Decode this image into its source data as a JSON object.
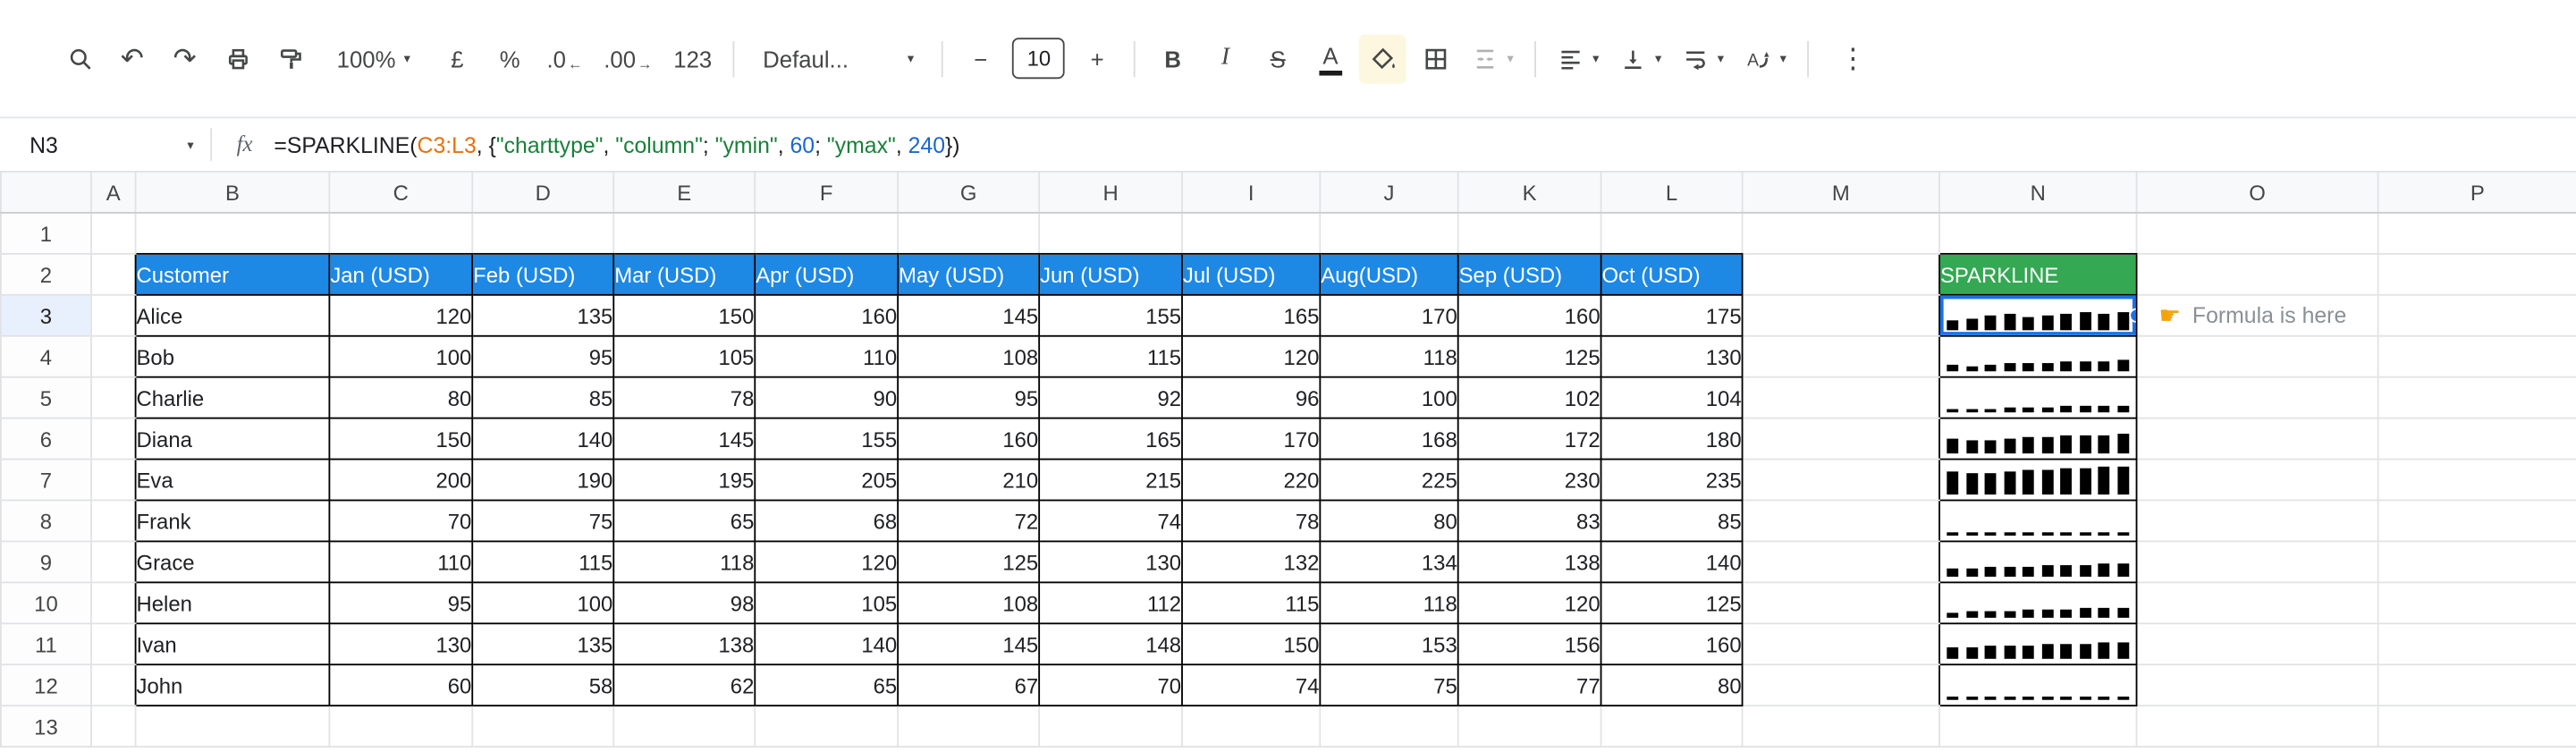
{
  "toolbar": {
    "zoom_value": "100%",
    "currency_label": "£",
    "percent_label": "%",
    "decrease_decimal_label": ".0",
    "increase_decimal_label": ".00",
    "number_format_label": "123",
    "font_value": "Defaul...",
    "minus_label": "−",
    "font_size_value": "10",
    "plus_label": "+",
    "bold_label": "B",
    "italic_label": "I",
    "strikethrough_label": "S",
    "text_color_label": "A",
    "more_label": "⋮",
    "icons": {
      "undo": "↶",
      "redo": "↷",
      "caret": "▾",
      "arrow_left": "←",
      "arrow_right": "→"
    }
  },
  "formula_bar": {
    "cell_ref": "N3",
    "fx_label": "fx",
    "colors": {
      "plain": "#202124",
      "range": "#e8710a",
      "string": "#188038",
      "number": "#1967d2"
    },
    "parts": [
      {
        "t": "=SPARKLINE(",
        "c": "plain"
      },
      {
        "t": "C3:L3",
        "c": "range"
      },
      {
        "t": ", {",
        "c": "plain"
      },
      {
        "t": "\"charttype\"",
        "c": "string"
      },
      {
        "t": ", ",
        "c": "plain"
      },
      {
        "t": "\"column\"",
        "c": "string"
      },
      {
        "t": "; ",
        "c": "plain"
      },
      {
        "t": "\"ymin\"",
        "c": "string"
      },
      {
        "t": ", ",
        "c": "plain"
      },
      {
        "t": "60",
        "c": "number"
      },
      {
        "t": "; ",
        "c": "plain"
      },
      {
        "t": "\"ymax\"",
        "c": "string"
      },
      {
        "t": ", ",
        "c": "plain"
      },
      {
        "t": "240",
        "c": "number"
      },
      {
        "t": "})",
        "c": "plain"
      }
    ]
  },
  "grid": {
    "column_letters": [
      "A",
      "B",
      "C",
      "D",
      "E",
      "F",
      "G",
      "H",
      "I",
      "J",
      "K",
      "L",
      "M",
      "N",
      "O",
      "P"
    ],
    "row_numbers": [
      1,
      2,
      3,
      4,
      5,
      6,
      7,
      8,
      9,
      10,
      11,
      12,
      13
    ],
    "selected_column": "N",
    "selected_row": 3,
    "selected_cell": "N3",
    "selection_color": "#1a73e8"
  },
  "table": {
    "header_bg": "#1e88e5",
    "headers": [
      "Customer",
      "Jan (USD)",
      "Feb (USD)",
      "Mar (USD)",
      "Apr (USD)",
      "May (USD)",
      "Jun (USD)",
      "Jul (USD)",
      "Aug(USD)",
      "Sep (USD)",
      "Oct (USD)"
    ],
    "rows": [
      {
        "customer": "Alice",
        "values": [
          120,
          135,
          150,
          160,
          145,
          155,
          165,
          170,
          160,
          175
        ]
      },
      {
        "customer": "Bob",
        "values": [
          100,
          95,
          105,
          110,
          108,
          115,
          120,
          118,
          125,
          130
        ]
      },
      {
        "customer": "Charlie",
        "values": [
          80,
          85,
          78,
          90,
          95,
          92,
          96,
          100,
          102,
          104
        ]
      },
      {
        "customer": "Diana",
        "values": [
          150,
          140,
          145,
          155,
          160,
          165,
          170,
          168,
          172,
          180
        ]
      },
      {
        "customer": "Eva",
        "values": [
          200,
          190,
          195,
          205,
          210,
          215,
          220,
          225,
          230,
          235
        ]
      },
      {
        "customer": "Frank",
        "values": [
          70,
          75,
          65,
          68,
          72,
          74,
          78,
          80,
          83,
          85
        ]
      },
      {
        "customer": "Grace",
        "values": [
          110,
          115,
          118,
          120,
          125,
          130,
          132,
          134,
          138,
          140
        ]
      },
      {
        "customer": "Helen",
        "values": [
          95,
          100,
          98,
          105,
          108,
          112,
          115,
          118,
          120,
          125
        ]
      },
      {
        "customer": "Ivan",
        "values": [
          130,
          135,
          138,
          140,
          145,
          148,
          150,
          153,
          156,
          160
        ]
      },
      {
        "customer": "John",
        "values": [
          60,
          58,
          62,
          65,
          67,
          70,
          74,
          75,
          77,
          80
        ]
      }
    ]
  },
  "sparkline": {
    "header": "SPARKLINE",
    "header_bg": "#34a853",
    "bar_color": "#000000",
    "ymin": 60,
    "ymax": 240
  },
  "annotation": {
    "pointer": "☛",
    "text": "Formula is here"
  }
}
